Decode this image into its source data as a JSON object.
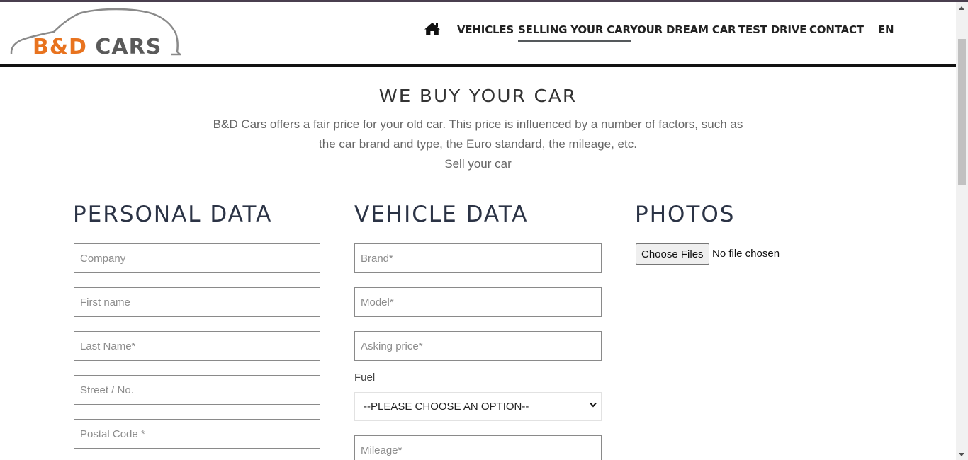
{
  "brand": {
    "logo_bd": "B&D",
    "logo_cars": "CARS",
    "orange": "#e8731f"
  },
  "nav": {
    "home_icon": "home-icon",
    "items": [
      {
        "label": "VEHICLES"
      },
      {
        "label": "SELLING YOUR CAR",
        "active": true
      },
      {
        "label": "YOUR DREAM CAR"
      },
      {
        "label": "TEST DRIVE"
      },
      {
        "label": "CONTACT"
      }
    ],
    "language": "EN"
  },
  "hero": {
    "title": "WE BUY YOUR CAR",
    "line1": "B&D Cars offers a fair price for your old car. This price is influenced by a number of factors, such as",
    "line2": "the car brand and type, the Euro standard, the mileage, etc.",
    "line3": "Sell your car"
  },
  "personal": {
    "title": "PERSONAL DATA",
    "company_placeholder": "Company",
    "first_name_placeholder": "First name",
    "last_name_placeholder": "Last Name*",
    "street_placeholder": "Street / No.",
    "postal_code_placeholder": "Postal Code *"
  },
  "vehicle": {
    "title": "VEHICLE DATA",
    "brand_placeholder": "Brand*",
    "model_placeholder": "Model*",
    "price_placeholder": "Asking price*",
    "fuel_label": "Fuel",
    "fuel_selected": "--PLEASE CHOOSE AN OPTION--",
    "mileage_placeholder": "Mileage*"
  },
  "photos": {
    "title": "PHOTOS",
    "button_label": "Choose Files",
    "file_status": "No file chosen"
  }
}
